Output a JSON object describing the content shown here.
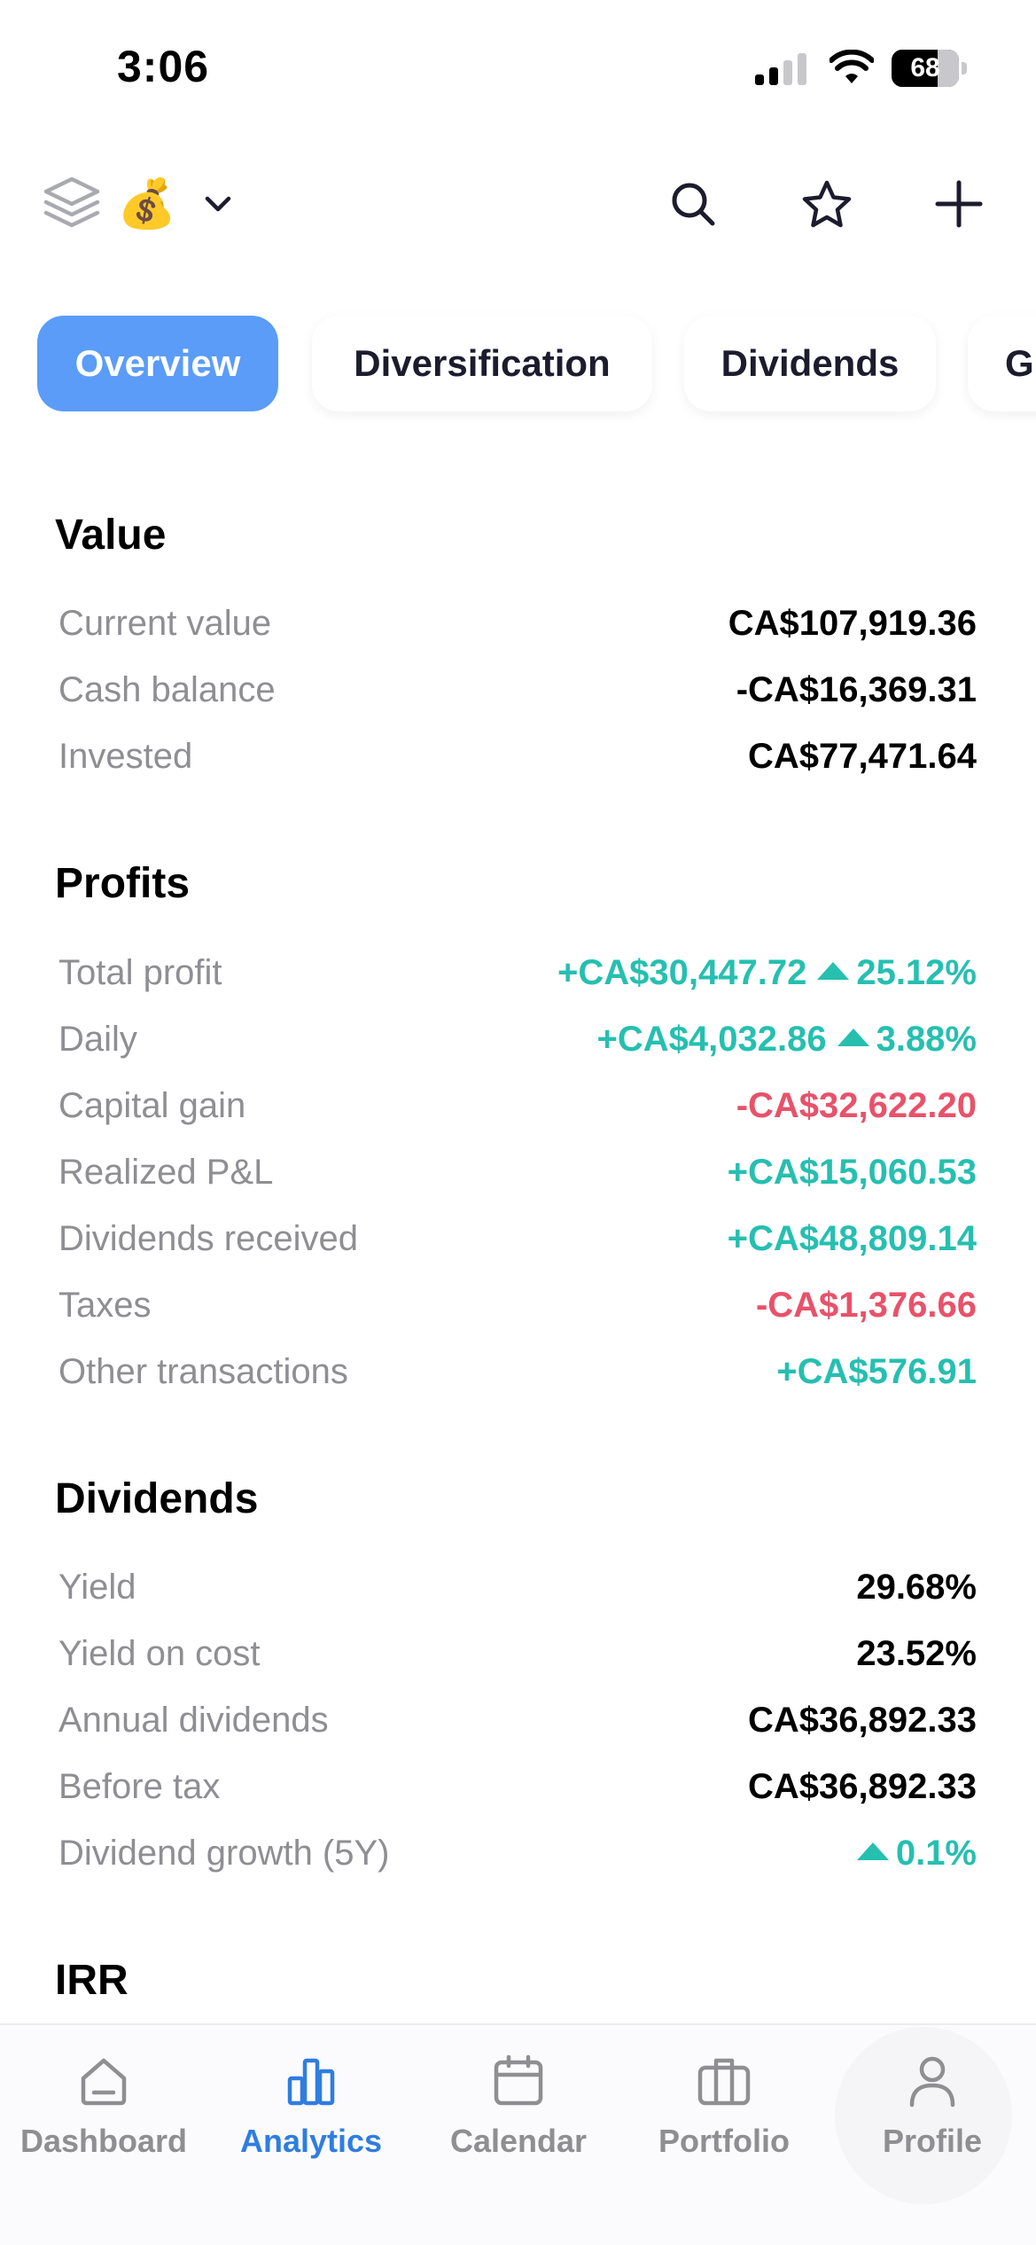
{
  "status_bar": {
    "time": "3:06",
    "battery": "68"
  },
  "header": {
    "icons": [
      "layers-icon",
      "money-bag-icon",
      "chevron-down-icon",
      "search-icon",
      "star-icon",
      "plus-icon"
    ],
    "portfolio_emoji": "💰"
  },
  "tabs": [
    {
      "label": "Overview",
      "active": true
    },
    {
      "label": "Diversification",
      "active": false
    },
    {
      "label": "Dividends",
      "active": false
    },
    {
      "label": "Gr",
      "active": false
    }
  ],
  "sections": {
    "value": {
      "title": "Value",
      "rows": [
        {
          "label": "Current value",
          "value": "CA$107,919.36"
        },
        {
          "label": "Cash balance",
          "value": "-CA$16,369.31"
        },
        {
          "label": "Invested",
          "value": "CA$77,471.64"
        }
      ]
    },
    "profits": {
      "title": "Profits",
      "rows": [
        {
          "label": "Total profit",
          "value": "+CA$30,447.72",
          "percent": "25.12%"
        },
        {
          "label": "Daily",
          "value": "+CA$4,032.86",
          "percent": "3.88%"
        },
        {
          "label": "Capital gain",
          "value": "-CA$32,622.20"
        },
        {
          "label": "Realized P&L",
          "value": "+CA$15,060.53"
        },
        {
          "label": "Dividends received",
          "value": "+CA$48,809.14"
        },
        {
          "label": "Taxes",
          "value": "-CA$1,376.66"
        },
        {
          "label": "Other transactions",
          "value": "+CA$576.91"
        }
      ]
    },
    "dividends": {
      "title": "Dividends",
      "rows": [
        {
          "label": "Yield",
          "value": "29.68%"
        },
        {
          "label": "Yield on cost",
          "value": "23.52%"
        },
        {
          "label": "Annual dividends",
          "value": "CA$36,892.33"
        },
        {
          "label": "Before tax",
          "value": "CA$36,892.33"
        },
        {
          "label": "Dividend growth (5Y)",
          "value": "0.1%"
        }
      ]
    },
    "irr": {
      "title": "IRR"
    }
  },
  "colors": {
    "positive": "#26bfb0",
    "negative": "#e8526a",
    "accent": "#5a9cf8",
    "nav_active": "#2f7de1"
  },
  "bottom_nav": [
    {
      "label": "Dashboard",
      "icon": "home-icon",
      "active": false
    },
    {
      "label": "Analytics",
      "icon": "bar-chart-icon",
      "active": true
    },
    {
      "label": "Calendar",
      "icon": "calendar-icon",
      "active": false
    },
    {
      "label": "Portfolio",
      "icon": "briefcase-icon",
      "active": false
    },
    {
      "label": "Profile",
      "icon": "person-icon",
      "active": false
    }
  ]
}
